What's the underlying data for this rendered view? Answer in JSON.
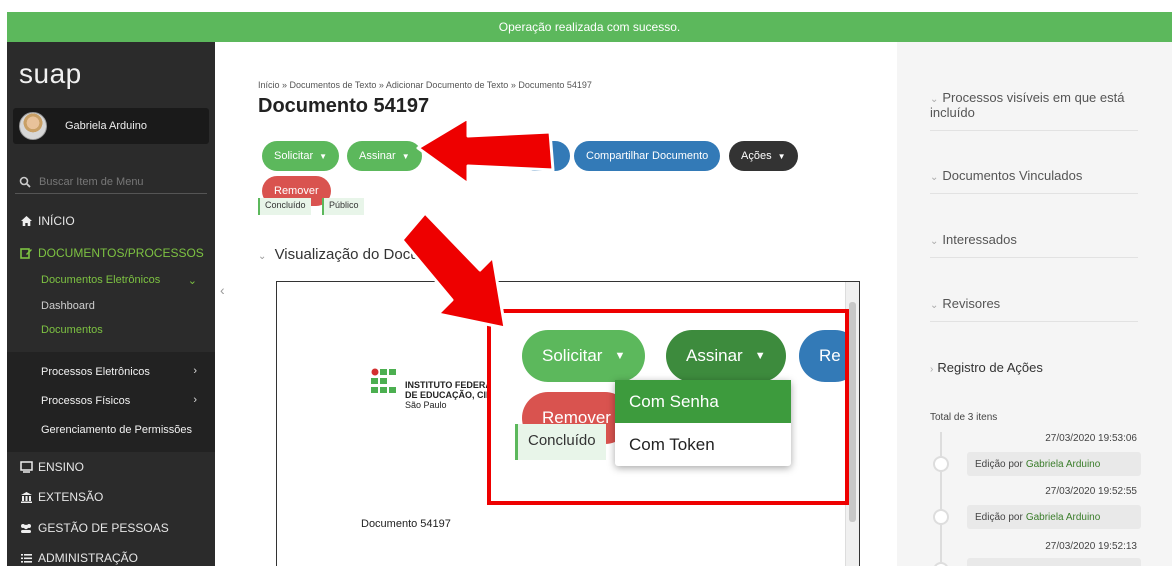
{
  "topbar": {
    "message": "Operação realizada com sucesso."
  },
  "sidebar": {
    "logo": "suap",
    "user": "Gabriela Arduino",
    "search_placeholder": "Buscar Item de Menu",
    "inicio": "INÍCIO",
    "documentos_processos": "DOCUMENTOS/PROCESSOS",
    "documentos_eletronicos": "Documentos Eletrônicos",
    "dashboard": "Dashboard",
    "documentos": "Documentos",
    "processos_eletronicos": "Processos Eletrônicos",
    "processos_fisicos": "Processos Físicos",
    "gerenciamento": "Gerenciamento de Permissões",
    "ensino": "ENSINO",
    "extensao": "EXTENSÃO",
    "gestao": "GESTÃO DE PESSOAS",
    "administracao": "ADMINISTRAÇÃO"
  },
  "main": {
    "breadcrumb": "Início » Documentos de Texto » Adicionar Documento de Texto » Documento 54197",
    "title": "Documento 54197",
    "buttons": {
      "solicitar": "Solicitar",
      "assinar": "Assinar",
      "compartilhar": "Compartilhar Documento",
      "acoes": "Ações",
      "remover": "Remover"
    },
    "tags": {
      "concluido": "Concluído",
      "publico": "Público"
    },
    "section_title": "Visualização do Docu",
    "preview": {
      "inst_line1": "INSTITUTO FEDERA",
      "inst_line2": "DE EDUCAÇÃO, CIÊ",
      "inst_line3": "São Paulo",
      "doc_label": "Documento 54197"
    }
  },
  "zoom": {
    "solicitar": "Solicitar",
    "assinar": "Assinar",
    "re": "Re",
    "remover": "Remover",
    "concluido": "Concluído",
    "dropdown": [
      "Com Senha",
      "Com Token"
    ]
  },
  "right_panel": {
    "processos": "Processos visíveis em que está incluído",
    "vinculados": "Documentos Vinculados",
    "interessados": "Interessados",
    "revisores": "Revisores",
    "registro": "Registro de Ações",
    "total": "Total de 3 itens",
    "timeline": [
      {
        "time": "27/03/2020 19:53:06",
        "action": "Edição por",
        "who": "Gabriela Arduino"
      },
      {
        "time": "27/03/2020 19:52:55",
        "action": "Edição por",
        "who": "Gabriela Arduino"
      },
      {
        "time": "27/03/2020 19:52:13"
      }
    ]
  },
  "colors": {
    "success": "#5cb85c",
    "primary": "#337ab7",
    "danger": "#d9534f",
    "highlight": "#e00000"
  }
}
